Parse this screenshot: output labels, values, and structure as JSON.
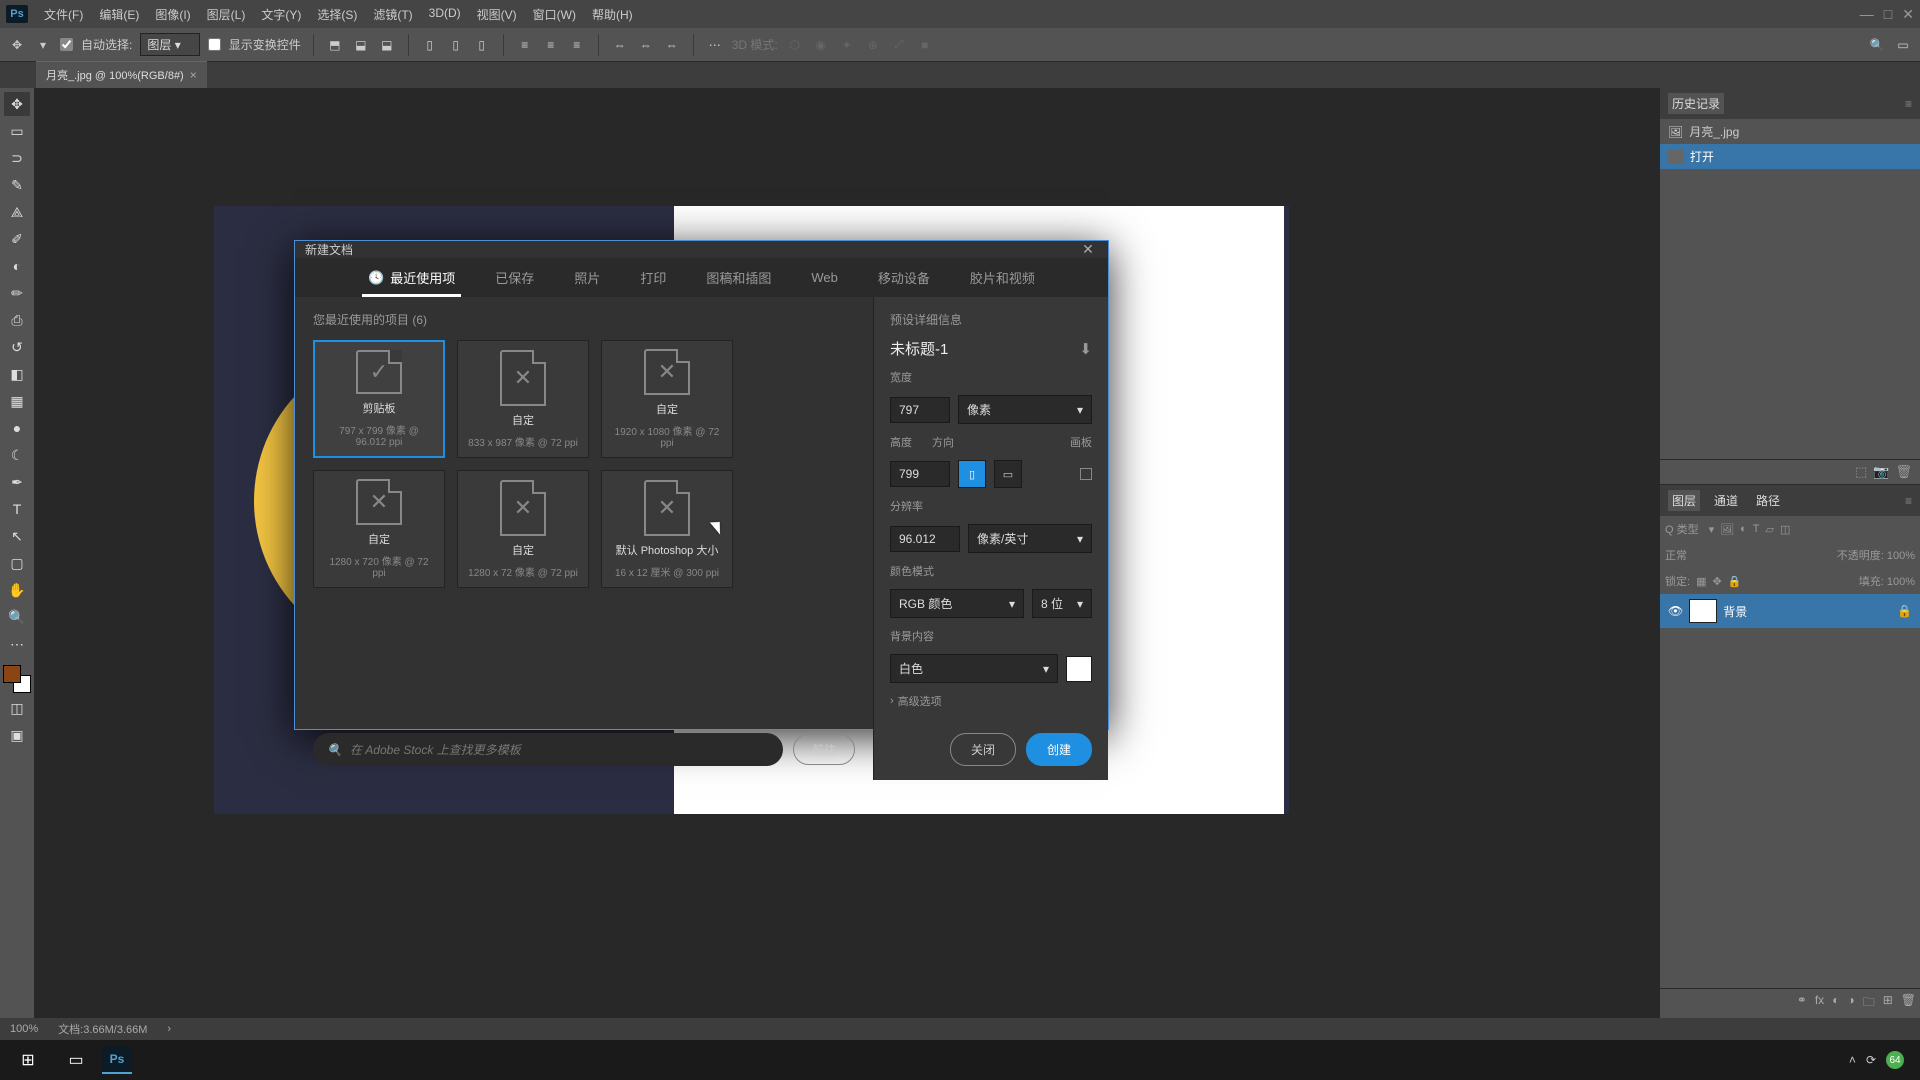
{
  "menubar": {
    "items": [
      "文件(F)",
      "编辑(E)",
      "图像(I)",
      "图层(L)",
      "文字(Y)",
      "选择(S)",
      "滤镜(T)",
      "3D(D)",
      "视图(V)",
      "窗口(W)",
      "帮助(H)"
    ]
  },
  "optbar": {
    "auto_select": "自动选择:",
    "layer_group": "图层",
    "show_transform": "显示变换控件",
    "mode3d": "3D 模式:"
  },
  "tab": {
    "label": "月亮_.jpg @ 100%(RGB/8#)"
  },
  "status": {
    "zoom": "100%",
    "docinfo": "文档:3.66M/3.66M"
  },
  "history": {
    "title": "历史记录",
    "file": "月亮_.jpg",
    "step": "打开"
  },
  "layers": {
    "tabs": [
      "图层",
      "通道",
      "路径"
    ],
    "kind": "Q 类型",
    "normal": "正常",
    "opacity": "不透明度: 100%",
    "lock": "锁定:",
    "fill": "填充: 100%",
    "layer_name": "背景"
  },
  "dialog": {
    "title": "新建文档",
    "tabs": [
      "最近使用项",
      "已保存",
      "照片",
      "打印",
      "图稿和插图",
      "Web",
      "移动设备",
      "胶片和视频"
    ],
    "recent_label": "您最近使用的项目 (6)",
    "presets": [
      {
        "name": "剪贴板",
        "detail": "797 x 799 像素 @ 96.012 ppi",
        "icon": "check",
        "sel": true
      },
      {
        "name": "自定",
        "detail": "833 x 987 像素 @ 72 ppi",
        "icon": "x"
      },
      {
        "name": "自定",
        "detail": "1920 x 1080 像素 @ 72 ppi",
        "icon": "x"
      },
      {
        "name": "自定",
        "detail": "1280 x 720 像素 @ 72 ppi",
        "icon": "x"
      },
      {
        "name": "自定",
        "detail": "1280 x 72 像素 @ 72 ppi",
        "icon": "x"
      },
      {
        "name": "默认 Photoshop 大小",
        "detail": "16 x 12 厘米 @ 300 ppi",
        "icon": "x"
      }
    ],
    "search_placeholder": "在 Adobe Stock 上查找更多模板",
    "go": "前往",
    "detail": {
      "header": "预设详细信息",
      "name": "未标题-1",
      "width_l": "宽度",
      "width_v": "797",
      "unit": "像素",
      "height_l": "高度",
      "height_v": "799",
      "orient_l": "方向",
      "artboard_l": "画板",
      "res_l": "分辨率",
      "res_v": "96.012",
      "res_unit": "像素/英寸",
      "mode_l": "颜色模式",
      "mode_v": "RGB 颜色",
      "bit": "8 位",
      "bg_l": "背景内容",
      "bg_v": "白色",
      "adv": "高级选项",
      "close": "关闭",
      "create": "创建"
    }
  },
  "tray": {
    "badge": "64"
  }
}
